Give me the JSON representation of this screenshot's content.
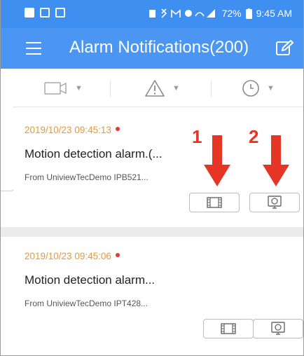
{
  "status_bar": {
    "battery": "72%",
    "time": "9:45 AM"
  },
  "header": {
    "title": "Alarm Notifications(200)",
    "menu_icon": "hamburger-menu-icon",
    "edit_icon": "edit-icon"
  },
  "filters": [
    {
      "icon": "camera-icon"
    },
    {
      "icon": "warning-icon"
    },
    {
      "icon": "clock-icon"
    }
  ],
  "alarms": [
    {
      "time": "2019/10/23 09:45:13",
      "title": "Motion detection alarm.(...",
      "from": "From UniviewTecDemo IPB521...",
      "buttons": [
        "playback-icon",
        "live-view-icon"
      ]
    },
    {
      "time": "2019/10/23 09:45:06",
      "title": "Motion detection alarm...",
      "from": "From UniviewTecDemo IPT428...",
      "buttons": [
        "playback-icon",
        "live-view-icon"
      ]
    }
  ],
  "annotations": {
    "label_1": "1",
    "label_2": "2"
  },
  "colors": {
    "header_blue": "#4a96f2",
    "timestamp_orange": "#e39a3b",
    "unread_dot_red": "#e53935",
    "annotation_red": "#e53525"
  }
}
